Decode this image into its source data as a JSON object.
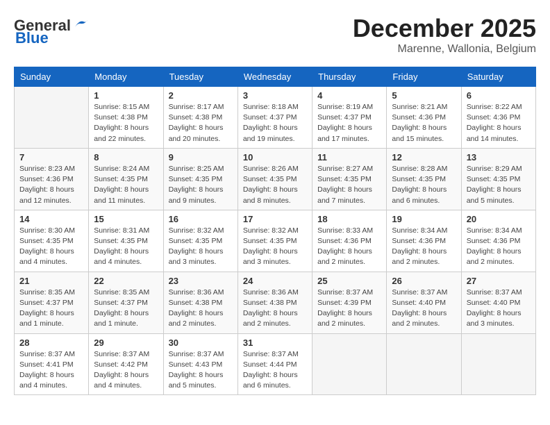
{
  "logo": {
    "general": "General",
    "blue": "Blue"
  },
  "header": {
    "month_year": "December 2025",
    "location": "Marenne, Wallonia, Belgium"
  },
  "days_of_week": [
    "Sunday",
    "Monday",
    "Tuesday",
    "Wednesday",
    "Thursday",
    "Friday",
    "Saturday"
  ],
  "weeks": [
    [
      {
        "day": "",
        "info": ""
      },
      {
        "day": "1",
        "info": "Sunrise: 8:15 AM\nSunset: 4:38 PM\nDaylight: 8 hours\nand 22 minutes."
      },
      {
        "day": "2",
        "info": "Sunrise: 8:17 AM\nSunset: 4:38 PM\nDaylight: 8 hours\nand 20 minutes."
      },
      {
        "day": "3",
        "info": "Sunrise: 8:18 AM\nSunset: 4:37 PM\nDaylight: 8 hours\nand 19 minutes."
      },
      {
        "day": "4",
        "info": "Sunrise: 8:19 AM\nSunset: 4:37 PM\nDaylight: 8 hours\nand 17 minutes."
      },
      {
        "day": "5",
        "info": "Sunrise: 8:21 AM\nSunset: 4:36 PM\nDaylight: 8 hours\nand 15 minutes."
      },
      {
        "day": "6",
        "info": "Sunrise: 8:22 AM\nSunset: 4:36 PM\nDaylight: 8 hours\nand 14 minutes."
      }
    ],
    [
      {
        "day": "7",
        "info": "Sunrise: 8:23 AM\nSunset: 4:36 PM\nDaylight: 8 hours\nand 12 minutes."
      },
      {
        "day": "8",
        "info": "Sunrise: 8:24 AM\nSunset: 4:35 PM\nDaylight: 8 hours\nand 11 minutes."
      },
      {
        "day": "9",
        "info": "Sunrise: 8:25 AM\nSunset: 4:35 PM\nDaylight: 8 hours\nand 9 minutes."
      },
      {
        "day": "10",
        "info": "Sunrise: 8:26 AM\nSunset: 4:35 PM\nDaylight: 8 hours\nand 8 minutes."
      },
      {
        "day": "11",
        "info": "Sunrise: 8:27 AM\nSunset: 4:35 PM\nDaylight: 8 hours\nand 7 minutes."
      },
      {
        "day": "12",
        "info": "Sunrise: 8:28 AM\nSunset: 4:35 PM\nDaylight: 8 hours\nand 6 minutes."
      },
      {
        "day": "13",
        "info": "Sunrise: 8:29 AM\nSunset: 4:35 PM\nDaylight: 8 hours\nand 5 minutes."
      }
    ],
    [
      {
        "day": "14",
        "info": "Sunrise: 8:30 AM\nSunset: 4:35 PM\nDaylight: 8 hours\nand 4 minutes."
      },
      {
        "day": "15",
        "info": "Sunrise: 8:31 AM\nSunset: 4:35 PM\nDaylight: 8 hours\nand 4 minutes."
      },
      {
        "day": "16",
        "info": "Sunrise: 8:32 AM\nSunset: 4:35 PM\nDaylight: 8 hours\nand 3 minutes."
      },
      {
        "day": "17",
        "info": "Sunrise: 8:32 AM\nSunset: 4:35 PM\nDaylight: 8 hours\nand 3 minutes."
      },
      {
        "day": "18",
        "info": "Sunrise: 8:33 AM\nSunset: 4:36 PM\nDaylight: 8 hours\nand 2 minutes."
      },
      {
        "day": "19",
        "info": "Sunrise: 8:34 AM\nSunset: 4:36 PM\nDaylight: 8 hours\nand 2 minutes."
      },
      {
        "day": "20",
        "info": "Sunrise: 8:34 AM\nSunset: 4:36 PM\nDaylight: 8 hours\nand 2 minutes."
      }
    ],
    [
      {
        "day": "21",
        "info": "Sunrise: 8:35 AM\nSunset: 4:37 PM\nDaylight: 8 hours\nand 1 minute."
      },
      {
        "day": "22",
        "info": "Sunrise: 8:35 AM\nSunset: 4:37 PM\nDaylight: 8 hours\nand 1 minute."
      },
      {
        "day": "23",
        "info": "Sunrise: 8:36 AM\nSunset: 4:38 PM\nDaylight: 8 hours\nand 2 minutes."
      },
      {
        "day": "24",
        "info": "Sunrise: 8:36 AM\nSunset: 4:38 PM\nDaylight: 8 hours\nand 2 minutes."
      },
      {
        "day": "25",
        "info": "Sunrise: 8:37 AM\nSunset: 4:39 PM\nDaylight: 8 hours\nand 2 minutes."
      },
      {
        "day": "26",
        "info": "Sunrise: 8:37 AM\nSunset: 4:40 PM\nDaylight: 8 hours\nand 2 minutes."
      },
      {
        "day": "27",
        "info": "Sunrise: 8:37 AM\nSunset: 4:40 PM\nDaylight: 8 hours\nand 3 minutes."
      }
    ],
    [
      {
        "day": "28",
        "info": "Sunrise: 8:37 AM\nSunset: 4:41 PM\nDaylight: 8 hours\nand 4 minutes."
      },
      {
        "day": "29",
        "info": "Sunrise: 8:37 AM\nSunset: 4:42 PM\nDaylight: 8 hours\nand 4 minutes."
      },
      {
        "day": "30",
        "info": "Sunrise: 8:37 AM\nSunset: 4:43 PM\nDaylight: 8 hours\nand 5 minutes."
      },
      {
        "day": "31",
        "info": "Sunrise: 8:37 AM\nSunset: 4:44 PM\nDaylight: 8 hours\nand 6 minutes."
      },
      {
        "day": "",
        "info": ""
      },
      {
        "day": "",
        "info": ""
      },
      {
        "day": "",
        "info": ""
      }
    ]
  ]
}
